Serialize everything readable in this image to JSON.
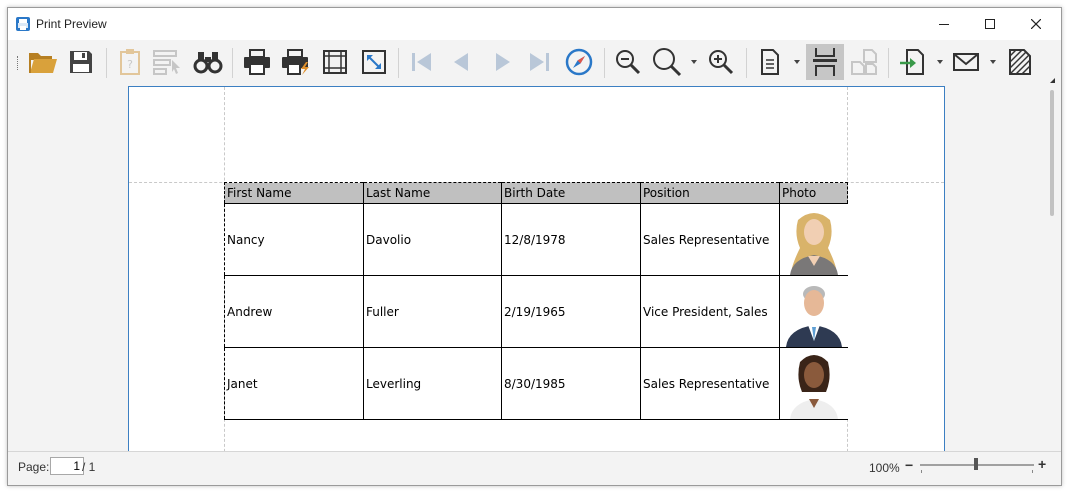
{
  "window": {
    "title": "Print Preview",
    "controls": {
      "minimize": "minimize-icon",
      "maximize": "maximize-icon",
      "close": "close-icon"
    }
  },
  "toolbar": {
    "items": [
      {
        "name": "open",
        "icon": "open-folder-icon",
        "enabled": true
      },
      {
        "name": "save",
        "icon": "floppy-disk-icon",
        "enabled": true
      },
      {
        "name": "parameters",
        "icon": "clipboard-question-icon",
        "enabled": false
      },
      {
        "name": "editing-fields",
        "icon": "select-fields-icon",
        "enabled": false
      },
      {
        "name": "search",
        "icon": "binoculars-icon",
        "enabled": true
      },
      {
        "name": "print",
        "icon": "printer-icon",
        "enabled": true
      },
      {
        "name": "quick-print",
        "icon": "quick-print-icon",
        "enabled": true
      },
      {
        "name": "page-setup",
        "icon": "page-setup-grid-icon",
        "enabled": true
      },
      {
        "name": "scale",
        "icon": "scale-expand-icon",
        "enabled": true
      },
      {
        "name": "first-page",
        "icon": "first-page-icon",
        "enabled": false
      },
      {
        "name": "previous-page",
        "icon": "previous-page-icon",
        "enabled": false
      },
      {
        "name": "next-page",
        "icon": "next-page-icon",
        "enabled": false
      },
      {
        "name": "last-page",
        "icon": "last-page-icon",
        "enabled": false
      },
      {
        "name": "navigation",
        "icon": "compass-icon",
        "enabled": true
      },
      {
        "name": "zoom-out",
        "icon": "zoom-out-icon",
        "enabled": true
      },
      {
        "name": "zoom",
        "icon": "zoom-icon",
        "enabled": true
      },
      {
        "name": "zoom-in",
        "icon": "zoom-in-icon",
        "enabled": true
      },
      {
        "name": "page-layout",
        "icon": "single-page-icon",
        "enabled": true
      },
      {
        "name": "continuous-layout",
        "icon": "continuous-pages-icon",
        "enabled": true,
        "pressed": true
      },
      {
        "name": "facing-pages",
        "icon": "facing-pages-icon",
        "enabled": false
      },
      {
        "name": "export",
        "icon": "export-document-icon",
        "enabled": true
      },
      {
        "name": "send-email",
        "icon": "envelope-icon",
        "enabled": true
      },
      {
        "name": "watermark",
        "icon": "watermark-icon",
        "enabled": true
      }
    ]
  },
  "report": {
    "columns": [
      "First Name",
      "Last Name",
      "Birth Date",
      "Position",
      "Photo"
    ],
    "rows": [
      {
        "first_name": "Nancy",
        "last_name": "Davolio",
        "birth_date": "12/8/1978",
        "position": "Sales Representative"
      },
      {
        "first_name": "Andrew",
        "last_name": "Fuller",
        "birth_date": "2/19/1965",
        "position": "Vice President, Sales"
      },
      {
        "first_name": "Janet",
        "last_name": "Leverling",
        "birth_date": "8/30/1985",
        "position": "Sales Representative"
      }
    ]
  },
  "statusbar": {
    "page_label": "Page:",
    "page_value": "1",
    "page_total": "/ 1",
    "zoom_label": "100%",
    "zoom_minus": "−",
    "zoom_plus": "+"
  },
  "colors": {
    "accent": "#3c7fc2",
    "header_fill": "#c0c0c0",
    "folder": "#d9a13b"
  }
}
